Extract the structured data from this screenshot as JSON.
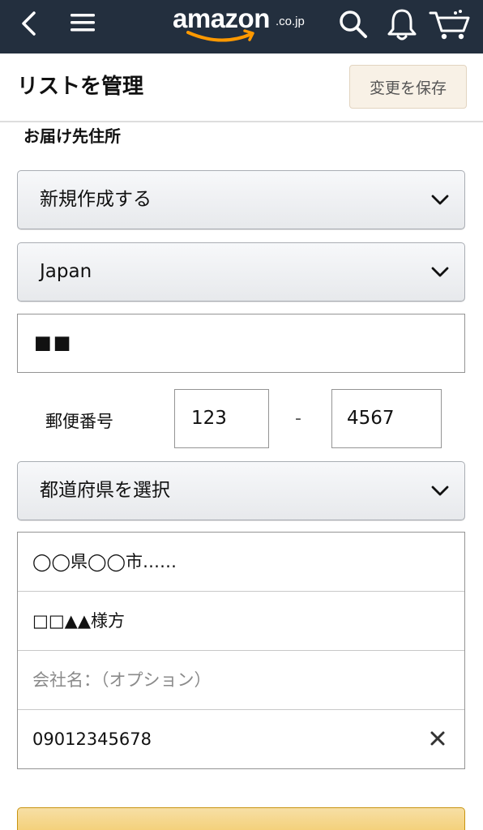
{
  "nav": {
    "logo_text": "amazon",
    "logo_suffix": ".co.jp",
    "icons": [
      "back-icon",
      "menu-icon",
      "search-icon",
      "bell-icon",
      "cart-icon"
    ],
    "background": "#232f3e",
    "logo_smile_color": "#ff9900"
  },
  "header": {
    "title": "リストを管理",
    "save_label": "変更を保存"
  },
  "section": {
    "label": "お届け先住所"
  },
  "form": {
    "address_select": "新規作成する",
    "country_select": "Japan",
    "name_value": "■■",
    "postal_label": "郵便番号",
    "postal_first": "123",
    "postal_dash": "-",
    "postal_second": "4567",
    "prefecture_select": "都道府県を選択",
    "address_line1": "◯◯県◯◯市……",
    "address_line2": "□□▲▲様方",
    "company_placeholder": "会社名：（オプション）",
    "phone_value": "09012345678"
  },
  "colors": {
    "continue_button": "#f0c14b",
    "save_button_bg": "#f8f1e6"
  }
}
